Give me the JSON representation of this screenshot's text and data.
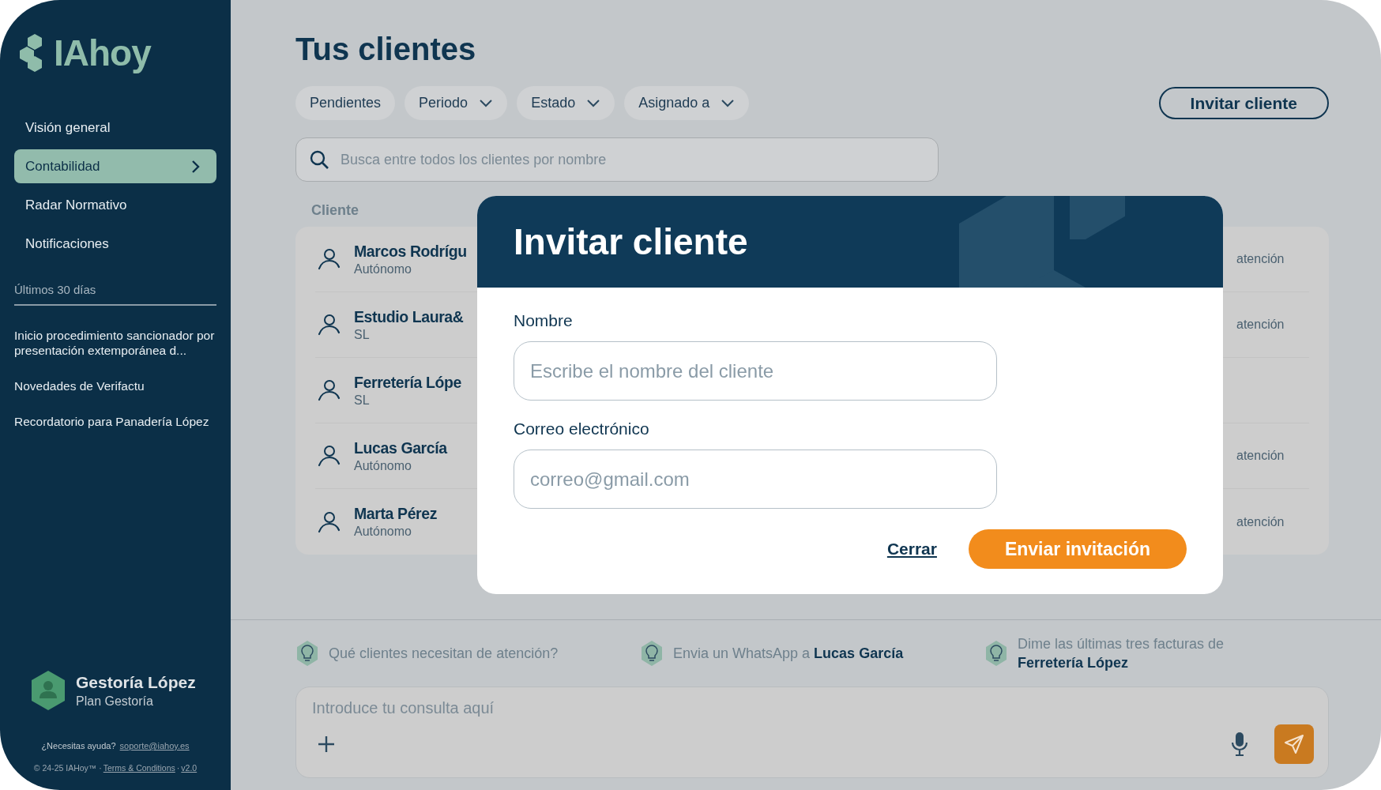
{
  "logo": {
    "text": "IAhoy"
  },
  "sidebar": {
    "nav": [
      {
        "label": "Visión general",
        "selected": false
      },
      {
        "label": "Contabilidad",
        "selected": true
      },
      {
        "label": "Radar Normativo",
        "selected": false
      },
      {
        "label": "Notificaciones",
        "selected": false
      }
    ],
    "section_title": "Últimos 30 días",
    "recent": [
      "Inicio procedimiento sancionador por presentación extemporánea d...",
      "Novedades de Verifactu",
      "Recordatorio para Panadería López"
    ],
    "profile": {
      "name": "Gestoría López",
      "plan": "Plan Gestoría"
    },
    "help": {
      "text": "¿Necesitas ayuda?",
      "link": "soporte@iahoy.es"
    },
    "footer": [
      {
        "text": "© 24-25 IAHoy™ ·",
        "kind": "text"
      },
      {
        "text": "Terms & Conditions",
        "kind": "link"
      },
      {
        "text": "·",
        "kind": "text"
      },
      {
        "text": "v2.0",
        "kind": "link"
      }
    ]
  },
  "page_title": "Tus clientes",
  "filters": [
    {
      "label": "Pendientes",
      "dropdown": false
    },
    {
      "label": "Periodo",
      "dropdown": true
    },
    {
      "label": "Estado",
      "dropdown": true
    },
    {
      "label": "Asignado a",
      "dropdown": true
    }
  ],
  "invite_button": "Invitar cliente",
  "search": {
    "placeholder": "Busca entre todos los clientes por nombre"
  },
  "table": {
    "columns": [
      "Cliente"
    ],
    "rows": [
      {
        "name": "Marcos Rodrígu",
        "type": "Autónomo",
        "column_2": "atención"
      },
      {
        "name": "Estudio Laura&",
        "type": "SL",
        "column_2": "atención"
      },
      {
        "name": "Ferretería Lópe",
        "type": "SL",
        "column_2": ""
      },
      {
        "name": "Lucas García",
        "type": "Autónomo",
        "column_2": "atención"
      },
      {
        "name": "Marta Pérez",
        "type": "Autónomo",
        "column_2": "atención"
      }
    ]
  },
  "suggestions": [
    "Qué clientes necesitan de atención?",
    "Envia un WhatsApp a **Lucas García**",
    "Dime las últimas tres facturas de **Ferretería López**"
  ],
  "chat": {
    "placeholder": "Introduce tu consulta aquí"
  },
  "modal": {
    "title": "Invitar cliente",
    "fields": [
      {
        "label": "Nombre",
        "placeholder": "Escribe el nombre del cliente"
      },
      {
        "label": "Correo electrónico",
        "placeholder": "correo@gmail.com"
      }
    ],
    "buttons": [
      {
        "label": "Cerrar",
        "kind": "link"
      },
      {
        "label": "Enviar invitación",
        "kind": "primary"
      }
    ]
  }
}
